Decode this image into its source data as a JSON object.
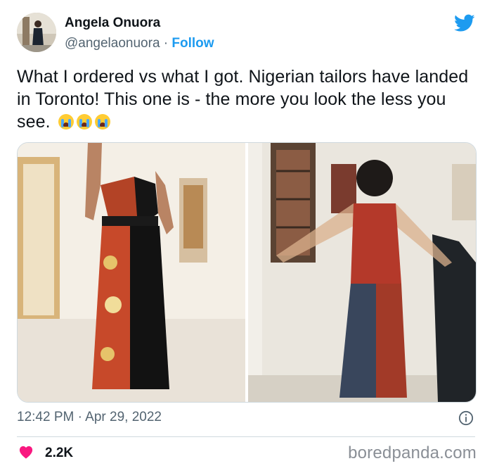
{
  "author": {
    "name": "Angela Onuora",
    "handle": "@angelaonuora",
    "separator": " · ",
    "follow_label": "Follow"
  },
  "tweet": {
    "text": "What I ordered vs what I got. Nigerian tailors have landed in Toronto! This one is - the more you look the less you see.",
    "emoji": [
      "loudly-crying-face",
      "loudly-crying-face",
      "loudly-crying-face"
    ],
    "timestamp": "12:42 PM · Apr 29, 2022",
    "likes": "2.2K"
  },
  "media": {
    "left_image": "what-ordered-photo",
    "right_image": "what-got-photo"
  },
  "watermark": "boredpanda.com",
  "colors": {
    "accent": "#1d9bf0",
    "like": "#f91880",
    "secondary_text": "#536471"
  }
}
